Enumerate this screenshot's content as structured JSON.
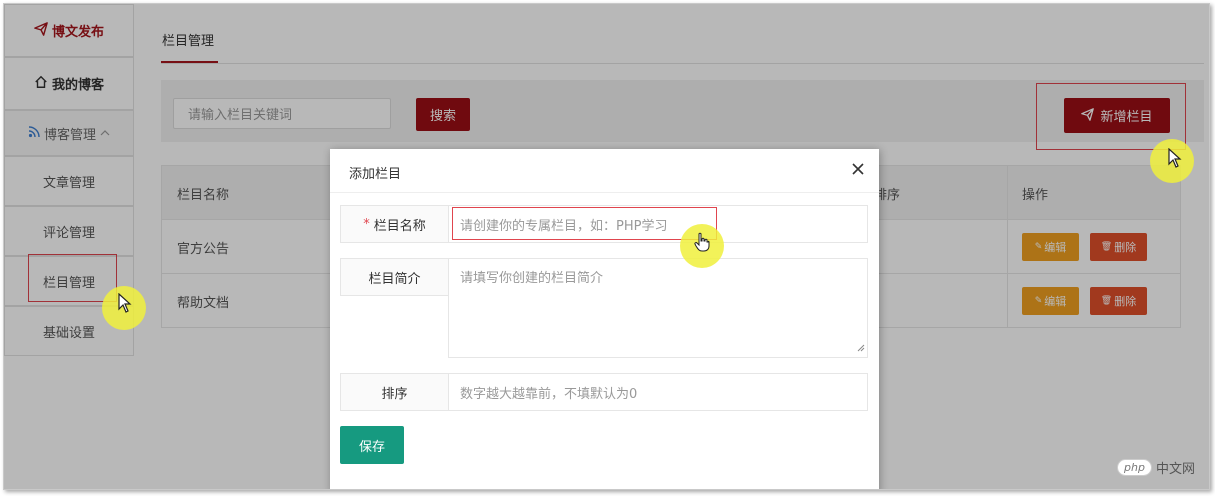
{
  "sidebar": {
    "publish": "博文发布",
    "my_blog": "我的博客",
    "blog_manage": "博客管理",
    "articles": "文章管理",
    "comments": "评论管理",
    "categories": "栏目管理",
    "settings": "基础设置"
  },
  "main": {
    "tab_label": "栏目管理",
    "search_placeholder": "请输入栏目关键词",
    "search_button": "搜索",
    "add_button": "新增栏目"
  },
  "table": {
    "headers": [
      "栏目名称",
      "排序",
      "操作"
    ],
    "rows": [
      {
        "name": "官方公告",
        "edit": "编辑",
        "delete": "删除"
      },
      {
        "name": "帮助文档",
        "edit": "编辑",
        "delete": "删除"
      }
    ]
  },
  "modal": {
    "title": "添加栏目",
    "close": "×",
    "name_label": "栏目名称",
    "name_required": "*",
    "name_placeholder": "请创建你的专属栏目，如：PHP学习",
    "desc_label": "栏目简介",
    "desc_placeholder": "请填写你创建的栏目简介",
    "order_label": "排序",
    "order_placeholder": "数字越大越靠前，不填默认为0",
    "save_button": "保存"
  },
  "watermark": {
    "logo": "php",
    "text": "中文网"
  },
  "icons": {
    "publish": "paper-plane-icon",
    "home": "home-icon",
    "group": "rss-icon",
    "edit": "pencil-icon",
    "delete": "trash-icon",
    "close": "close-icon"
  }
}
